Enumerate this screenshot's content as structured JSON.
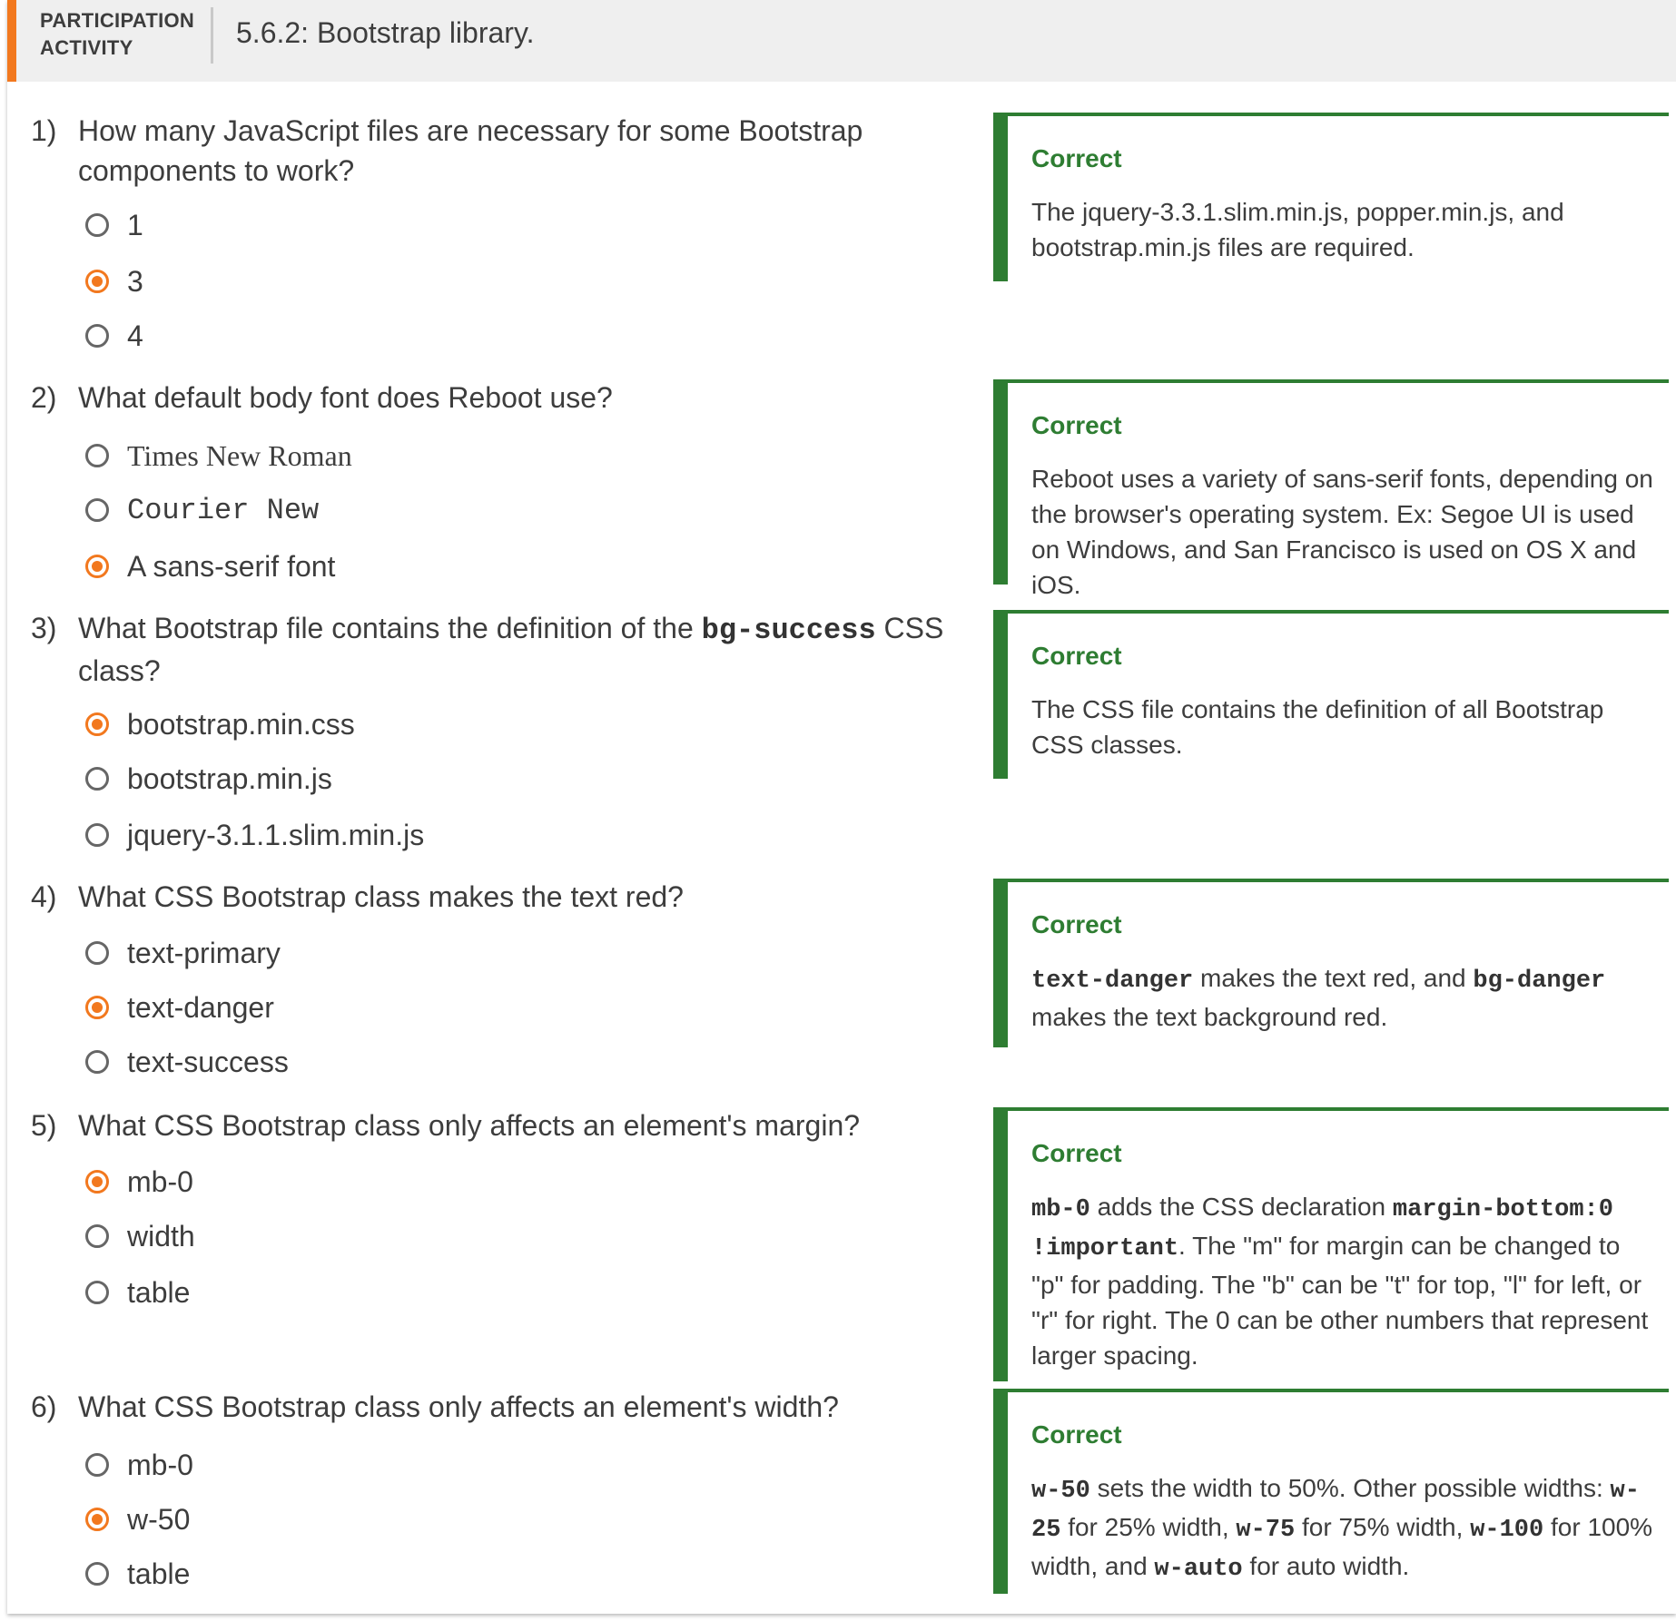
{
  "header": {
    "label_line1": "PARTICIPATION",
    "label_line2": "ACTIVITY",
    "title": "5.6.2: Bootstrap library."
  },
  "colors": {
    "accent": "#f2781e",
    "correct": "#2e7d32",
    "header_bg": "#efefef"
  },
  "questions": [
    {
      "number": "1)",
      "text": "How many JavaScript files are necessary for some Bootstrap components to work?",
      "options": [
        {
          "label": "1",
          "selected": false
        },
        {
          "label": "3",
          "selected": true
        },
        {
          "label": "4",
          "selected": false
        }
      ],
      "feedback": {
        "status": "Correct",
        "text": "The jquery-3.3.1.slim.min.js, popper.min.js, and bootstrap.min.js files are required."
      }
    },
    {
      "number": "2)",
      "text": "What default body font does Reboot use?",
      "options": [
        {
          "label": "Times New Roman",
          "selected": false
        },
        {
          "label": "Courier New",
          "selected": false
        },
        {
          "label": "A sans-serif font",
          "selected": true
        }
      ],
      "feedback": {
        "status": "Correct",
        "text": "Reboot uses a variety of sans-serif fonts, depending on the browser's operating system. Ex: Segoe UI is used on Windows, and San Francisco is used on OS X and iOS."
      }
    },
    {
      "number": "3)",
      "text_before": "What Bootstrap file contains the definition of the",
      "text_code": "bg-success",
      "text_after": "CSS class?",
      "options": [
        {
          "label": "bootstrap.min.css",
          "selected": true
        },
        {
          "label": "bootstrap.min.js",
          "selected": false
        },
        {
          "label": "jquery-3.1.1.slim.min.js",
          "selected": false
        }
      ],
      "feedback": {
        "status": "Correct",
        "text": "The CSS file contains the definition of all Bootstrap CSS classes."
      }
    },
    {
      "number": "4)",
      "text": "What CSS Bootstrap class makes the text red?",
      "options": [
        {
          "label": "text-primary",
          "selected": false
        },
        {
          "label": "text-danger",
          "selected": true
        },
        {
          "label": "text-success",
          "selected": false
        }
      ],
      "feedback": {
        "status": "Correct",
        "code1": "text-danger",
        "text1": "makes the text red, and",
        "code2": "bg-danger",
        "text2": "makes the text background red."
      }
    },
    {
      "number": "5)",
      "text": "What CSS Bootstrap class only affects an element's margin?",
      "options": [
        {
          "label": "mb-0",
          "selected": true
        },
        {
          "label": "width",
          "selected": false
        },
        {
          "label": "table",
          "selected": false
        }
      ],
      "feedback": {
        "status": "Correct",
        "code1": "mb-0",
        "text1": "adds the CSS declaration",
        "code2": "margin-bottom:0 !important",
        "text2": ". The \"m\" for margin can be changed to \"p\" for padding. The \"b\" can be \"t\" for top, \"l\" for left, or \"r\" for right. The 0 can be other numbers that represent larger spacing."
      }
    },
    {
      "number": "6)",
      "text": "What CSS Bootstrap class only affects an element's width?",
      "options": [
        {
          "label": "mb-0",
          "selected": false
        },
        {
          "label": "w-50",
          "selected": true
        },
        {
          "label": "table",
          "selected": false
        }
      ],
      "feedback": {
        "status": "Correct",
        "code1": "w-50",
        "text1": "sets the width to 50%. Other possible widths:",
        "code2": "w-25",
        "text2": "for 25% width,",
        "code3": "w-75",
        "text3": "for 75% width,",
        "code4": "w-100",
        "text4": "for 100% width, and",
        "code5": "w-auto",
        "text5": "for auto width."
      }
    }
  ]
}
